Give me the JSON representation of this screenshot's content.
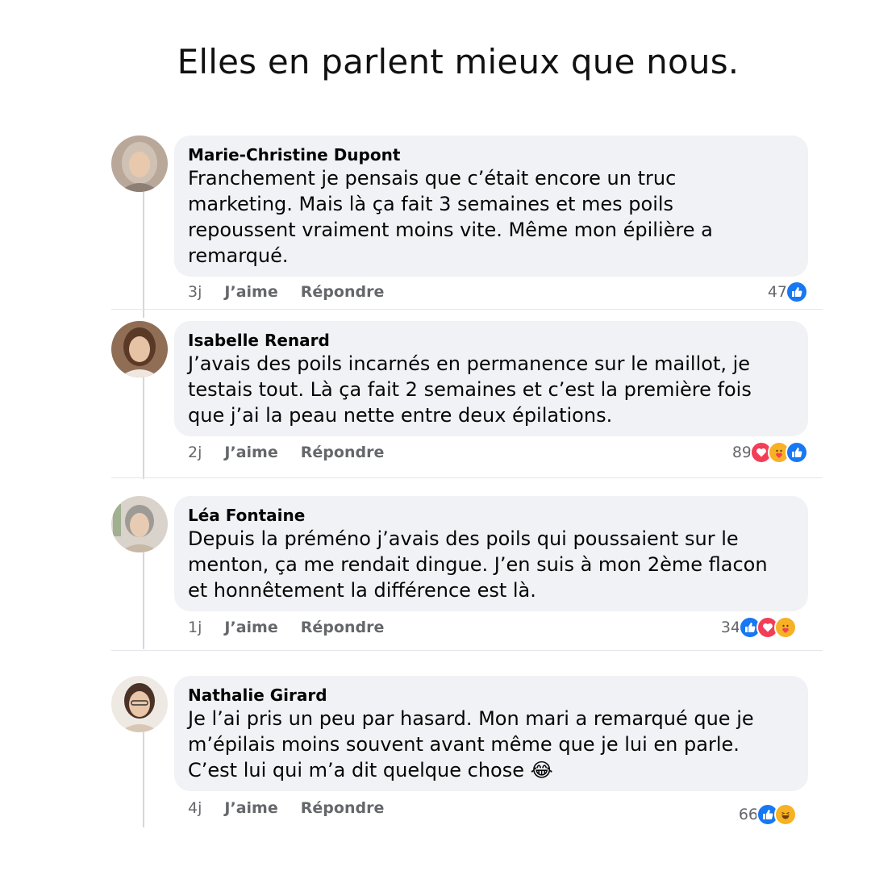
{
  "headline": "Elles en parlent mieux que nous.",
  "ui": {
    "like_label": "J’aime",
    "reply_label": "Répondre"
  },
  "colors": {
    "bubble": "#f0f2f5",
    "like_blue": "#1877f2",
    "love_red": "#f33e58",
    "care_yellow": "#f7b125",
    "meta_gray": "#65676b"
  },
  "comments": [
    {
      "author": "Marie-Christine Dupont",
      "text": "Franchement je pensais que c’était encore un truc\nmarketing. Mais là ça fait 3 semaines et mes poils\nrepoussent vraiment moins vite. Même mon épilière a\nremarqué.",
      "time": "3j",
      "reaction_count": "47",
      "reactions": [
        "like-icon"
      ]
    },
    {
      "author": "Isabelle Renard",
      "text": "J’avais des poils incarnés en permanence sur le maillot, je\ntestais tout. Là ça fait 2 semaines et c’est la première fois\nque j’ai la peau nette entre deux épilations.",
      "time": "2j",
      "reaction_count": "89",
      "reactions": [
        "love-icon",
        "care-icon",
        "like-icon"
      ]
    },
    {
      "author": "Léa Fontaine",
      "text": "Depuis la préméno j’avais des poils qui poussaient sur le\nmenton, ça me rendait dingue. J’en suis à mon 2ème flacon\net honnêtement la différence est là.",
      "time": "1j",
      "reaction_count": "34",
      "reactions": [
        "like-icon",
        "love-icon",
        "care-icon"
      ]
    },
    {
      "author": "Nathalie Girard",
      "text": "Je l’ai pris un peu par hasard. Mon mari a remarqué que je\nm’épilais moins souvent avant même que je lui en parle.\nC’est lui qui m’a dit quelque chose 😂",
      "time": "4j",
      "reaction_count": "66",
      "reactions": [
        "like-icon",
        "haha-icon"
      ]
    }
  ]
}
